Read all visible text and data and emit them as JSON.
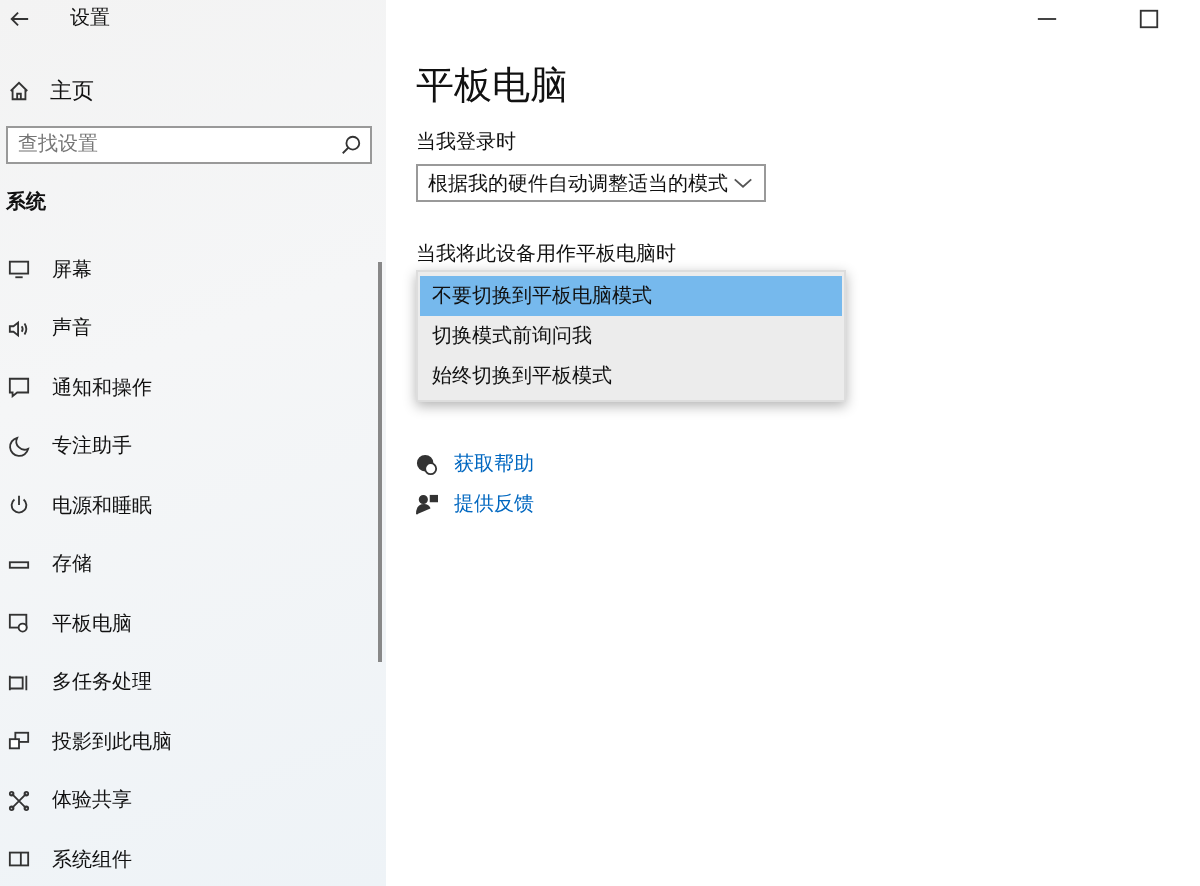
{
  "window": {
    "title": "设置"
  },
  "sidebar": {
    "home": "主页",
    "search": {
      "placeholder": "查找设置"
    },
    "section": "系统",
    "items": [
      {
        "label": "屏幕"
      },
      {
        "label": "声音"
      },
      {
        "label": "通知和操作"
      },
      {
        "label": "专注助手"
      },
      {
        "label": "电源和睡眠"
      },
      {
        "label": "存储"
      },
      {
        "label": "平板电脑"
      },
      {
        "label": "多任务处理"
      },
      {
        "label": "投影到此电脑"
      },
      {
        "label": "体验共享"
      },
      {
        "label": "系统组件"
      }
    ]
  },
  "page": {
    "title": "平板电脑",
    "signin_label": "当我登录时",
    "signin_value": "根据我的硬件自动调整适当的模式",
    "tablet_label": "当我将此设备用作平板电脑时",
    "tablet_options": [
      {
        "label": "不要切换到平板电脑模式",
        "selected": true
      },
      {
        "label": "切换模式前询问我",
        "selected": false
      },
      {
        "label": "始终切换到平板模式",
        "selected": false
      }
    ],
    "links": [
      {
        "label": "获取帮助"
      },
      {
        "label": "提供反馈"
      }
    ]
  }
}
